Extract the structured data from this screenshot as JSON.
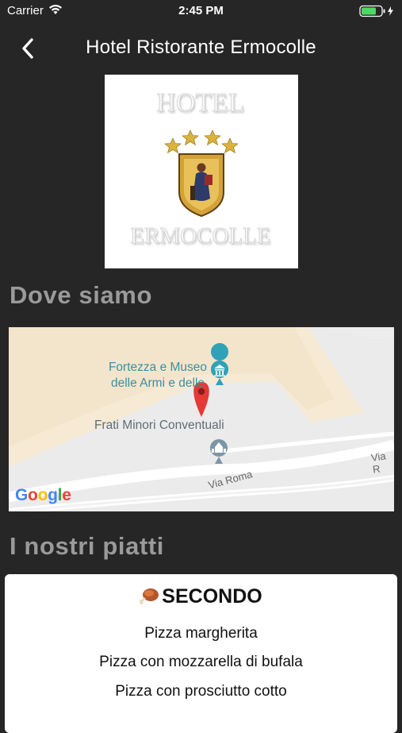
{
  "status_bar": {
    "carrier": "Carrier",
    "time": "2:45 PM"
  },
  "nav": {
    "title": "Hotel Ristorante Ermocolle",
    "back_icon": "chevron-left-icon"
  },
  "logo": {
    "line1": "HOTEL",
    "line2": "ERMOCOLLE",
    "stars": 4
  },
  "sections": {
    "location_title": "Dove siamo",
    "dishes_title": "I nostri piatti"
  },
  "map": {
    "poi_1": "Fortezza e Museo delle Armi e delle",
    "poi_2": "Frati Minori Conventuali",
    "street_1": "Via Roma",
    "street_2": "Via R",
    "provider": "Google"
  },
  "menu": {
    "category": "SECONDO",
    "category_icon": "meat-icon",
    "dishes": [
      "Pizza margherita",
      "Pizza con mozzarella di bufala",
      "Pizza con prosciutto cotto"
    ]
  },
  "colors": {
    "background": "#262626",
    "section_title": "#9a9a9a",
    "map_pin": "#e53935",
    "poi_text": "#3d8fa2"
  }
}
